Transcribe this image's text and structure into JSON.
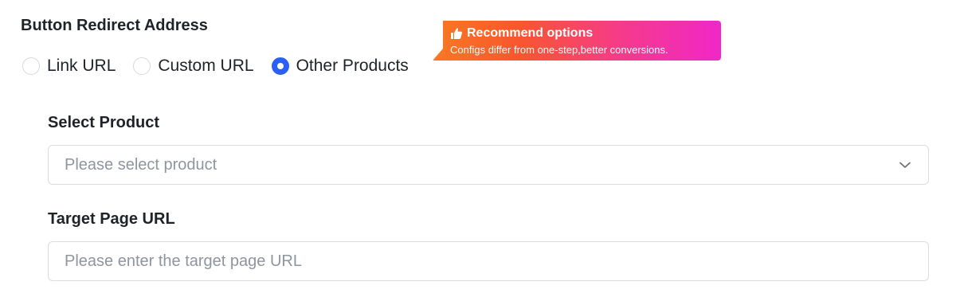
{
  "section": {
    "title": "Button Redirect Address"
  },
  "redirect_options": [
    {
      "label": "Link URL",
      "checked": false
    },
    {
      "label": "Custom URL",
      "checked": false
    },
    {
      "label": "Other Products",
      "checked": true
    }
  ],
  "recommend_badge": {
    "icon": "thumbs-up-icon",
    "title": "Recommend options",
    "subtitle": "Configs differ from one-step,better conversions."
  },
  "select_product": {
    "label": "Select Product",
    "placeholder": "Please select product",
    "icon": "chevron-down-icon"
  },
  "target_url": {
    "label": "Target Page URL",
    "placeholder": "Please enter the target page URL",
    "value": ""
  },
  "colors": {
    "accent": "#2c5ff6",
    "badge_gradient": [
      "#f87a22",
      "#f53b8a",
      "#f027c8"
    ],
    "placeholder": "#8f959e",
    "border": "#d9dce1"
  }
}
